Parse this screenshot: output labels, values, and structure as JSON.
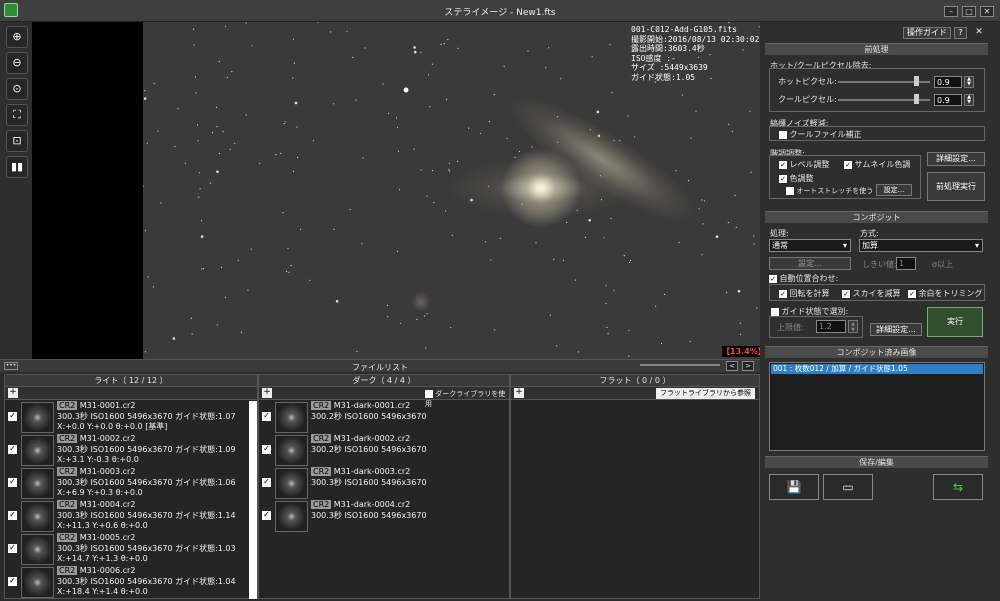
{
  "window": {
    "title": "ステライメージ - New1.fts"
  },
  "header": {
    "guide_button": "操作ガイド",
    "help_button": "?",
    "close_button": "✕"
  },
  "viewer": {
    "info_lines": [
      "001-C012-Add-G105.fits",
      "撮影開始:2016/08/13 02:30:02",
      "露出時間:3603.4秒",
      "ISO感度 :-",
      "サイズ :5449x3639",
      "ガイド状態:1.05"
    ],
    "zoom": "【13.4%】"
  },
  "filelist": {
    "title": "ファイルリスト",
    "light": {
      "header": "ライト（ 12 / 12 ）",
      "items": [
        {
          "tag": "CR2",
          "name": "M31-0001.cr2",
          "line2": "300.3秒 ISO1600 5496x3670 ガイド状態:1.07",
          "line3": "X:+0.0 Y:+0.0 θ:+0.0 [基準]"
        },
        {
          "tag": "CR2",
          "name": "M31-0002.cr2",
          "line2": "300.3秒 ISO1600 5496x3670 ガイド状態:1.09",
          "line3": "X:+3.1 Y:-0.3 θ:+0.0"
        },
        {
          "tag": "CR2",
          "name": "M31-0003.cr2",
          "line2": "300.3秒 ISO1600 5496x3670 ガイド状態:1.06",
          "line3": "X:+6.9 Y:+0.3 θ:+0.0"
        },
        {
          "tag": "CR2",
          "name": "M31-0004.cr2",
          "line2": "300.3秒 ISO1600 5496x3670 ガイド状態:1.14",
          "line3": "X:+11.3 Y:+0.6 θ:+0.0"
        },
        {
          "tag": "CR2",
          "name": "M31-0005.cr2",
          "line2": "300.3秒 ISO1600 5496x3670 ガイド状態:1.03",
          "line3": "X:+14.7 Y:+1.3 θ:+0.0"
        },
        {
          "tag": "CR2",
          "name": "M31-0006.cr2",
          "line2": "300.3秒 ISO1600 5496x3670 ガイド状態:1.04",
          "line3": "X:+18.4 Y:+1.4 θ:+0.0"
        }
      ]
    },
    "dark": {
      "header": "ダーク（ 4 / 4 ）",
      "library_label": "ダークライブラリを使用",
      "items": [
        {
          "tag": "CR2",
          "name": "M31-dark-0001.cr2",
          "line2": "300.2秒 ISO1600 5496x3670"
        },
        {
          "tag": "CR2",
          "name": "M31-dark-0002.cr2",
          "line2": "300.2秒 ISO1600 5496x3670"
        },
        {
          "tag": "CR2",
          "name": "M31-dark-0003.cr2",
          "line2": "300.3秒 ISO1600 5496x3670"
        },
        {
          "tag": "CR2",
          "name": "M31-dark-0004.cr2",
          "line2": "300.3秒 ISO1600 5496x3670"
        }
      ]
    },
    "flat": {
      "header": "フラット（ 0 / 0 ）",
      "library_button": "フラットライブラリから参照"
    }
  },
  "preprocess": {
    "title": "前処理",
    "hot_cool_label": "ホット/クールピクセル除去:",
    "hot_label": "ホットピクセル:",
    "hot_value": "0.9",
    "cool_label": "クールピクセル:",
    "cool_value": "0.9",
    "noise_label": "縞缰ノイズ軽減:",
    "cool_file_label": "クールファイル補正",
    "tone_label": "階調調整:",
    "level_label": "レベル調整",
    "thumb_color_label": "サムネイル色調",
    "color_label": "色調整",
    "auto_stretch_label": "オートストレッチを使う",
    "settings_btn": "設定...",
    "detail_btn": "詳細設定...",
    "run_btn": "前処理実行"
  },
  "composite": {
    "title": "コンポジット",
    "process_label": "処理:",
    "process_value": "通常",
    "method_label": "方式:",
    "method_value": "加算",
    "settings_btn": "設定...",
    "threshold_label": "しきい値:",
    "threshold_value": "1",
    "threshold_unit": "σ以上",
    "auto_align_label": "自動位置合わせ:",
    "rotate_label": "回転を計算",
    "sky_label": "スカイを減算",
    "trim_label": "余白をトリミング",
    "guide_select_label": "ガイド状態で選別:",
    "upper_label": "上限値:",
    "upper_value": "1.2",
    "detail_btn": "詳細設定...",
    "run_btn": "実行"
  },
  "composited": {
    "title": "コンポジット済み画像",
    "items": [
      "001 : 枚数012 / 加算 / ガイド状態1.05"
    ]
  },
  "save": {
    "title": "保存/編集"
  }
}
